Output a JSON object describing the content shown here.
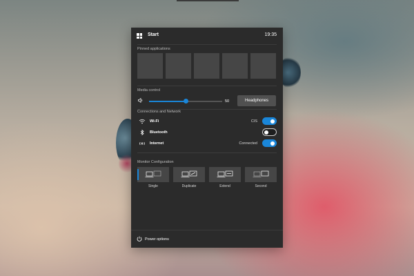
{
  "panel": {
    "title": "Start",
    "time": "19:35"
  },
  "pinned": {
    "label": "Pinned applications",
    "tiles": [
      {},
      {},
      {},
      {},
      {}
    ]
  },
  "media": {
    "label": "Media control",
    "volume": 50,
    "volume_text": "50",
    "output_button": "Headphones"
  },
  "network": {
    "label": "Connections and Network",
    "items": [
      {
        "name": "Wi-Fi",
        "status": "CIS",
        "on": true,
        "icon": "wifi-icon"
      },
      {
        "name": "Bluetooth",
        "status": "",
        "on": false,
        "icon": "bluetooth-icon"
      },
      {
        "name": "Internet",
        "status": "Connected",
        "on": true,
        "icon": "internet-icon"
      }
    ]
  },
  "monitor": {
    "label": "Monitor Configuration",
    "options": [
      {
        "label": "Single",
        "selected": true
      },
      {
        "label": "Duplicate",
        "selected": false
      },
      {
        "label": "Extend",
        "selected": false
      },
      {
        "label": "Second",
        "selected": false
      }
    ]
  },
  "footer": {
    "power_label": "Power options"
  },
  "colors": {
    "accent": "#1a86d9",
    "panel_bg": "#2b2b2b",
    "tile_bg": "#464646"
  }
}
